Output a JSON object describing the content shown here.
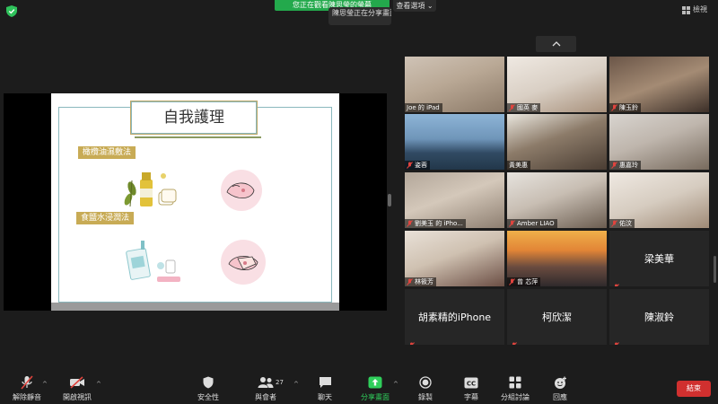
{
  "top": {
    "share_banner": "您正在觀看陳思瑩的螢幕",
    "presenter_popup": "陳思瑩正在分享畫面",
    "view_options": "查看選項",
    "view_button": "檢視"
  },
  "slide": {
    "title": "自我護理",
    "section_1": "橄欖油濕敷法",
    "section_2": "食鹽水浸潤法"
  },
  "participants": [
    {
      "name": "Joe 的 iPad",
      "muted": false,
      "video": true
    },
    {
      "name": "國英 麥",
      "muted": true,
      "video": true
    },
    {
      "name": "陳玉鈴",
      "muted": true,
      "video": true
    },
    {
      "name": "姿蓉",
      "muted": true,
      "video": true
    },
    {
      "name": "黃美惠",
      "muted": false,
      "video": true
    },
    {
      "name": "惠嘉玲",
      "muted": true,
      "video": true
    },
    {
      "name": "劉美玉 的 iPho...",
      "muted": true,
      "video": true
    },
    {
      "name": "Amber LIAO",
      "muted": true,
      "video": true
    },
    {
      "name": "佑汶",
      "muted": true,
      "video": true
    },
    {
      "name": "林筱芳",
      "muted": true,
      "video": true
    },
    {
      "name": "曾 芯萍",
      "muted": true,
      "video": true
    },
    {
      "name": "梁美華",
      "muted": true,
      "video": false
    },
    {
      "name": "胡素精的iPhone",
      "muted": true,
      "video": false
    },
    {
      "name": "柯欣潔",
      "muted": true,
      "video": false
    },
    {
      "name": "陳淑鈴",
      "muted": true,
      "video": false
    }
  ],
  "toolbar": {
    "unmute": "解除靜音",
    "start_video": "開啟視訊",
    "security": "安全性",
    "participants": "與會者",
    "participants_count": "27",
    "chat": "聊天",
    "share_screen": "分享畫面",
    "record": "錄製",
    "captions": "字幕",
    "breakout": "分組討論",
    "reactions": "回應",
    "end": "結束",
    "captions_icon_text": "CC"
  },
  "colors": {
    "accent_green": "#23a94c",
    "end_red": "#d0302f",
    "slide_tag_gold": "#c8ab55",
    "muted_red": "#e0443e"
  }
}
